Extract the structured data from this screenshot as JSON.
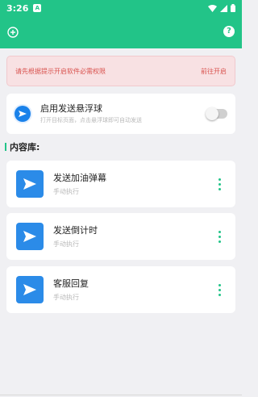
{
  "status_bar": {
    "time": "3:26",
    "app_indicator": "A"
  },
  "toolbar": {
    "help_label": "?"
  },
  "warning": {
    "text": "请先根据提示开启软件必需权限",
    "action": "前往开启"
  },
  "float_ball": {
    "title": "启用发送悬浮球",
    "subtitle": "打开目标页面，点击悬浮球即可自动发送",
    "enabled": false
  },
  "section": {
    "title": "内容库:"
  },
  "items": [
    {
      "title": "发送加油弹幕",
      "subtitle": "手动执行"
    },
    {
      "title": "发送倒计时",
      "subtitle": "手动执行"
    },
    {
      "title": "客服回复",
      "subtitle": "手动执行"
    }
  ],
  "colors": {
    "accent": "#22c488",
    "icon_blue": "#2b8be8",
    "warning_text": "#d9534f",
    "warning_bg": "#f8e1e3"
  },
  "icons": [
    "add-icon",
    "help-icon",
    "send-icon",
    "more-vertical-icon",
    "wifi-icon",
    "signal-icon",
    "battery-icon"
  ]
}
